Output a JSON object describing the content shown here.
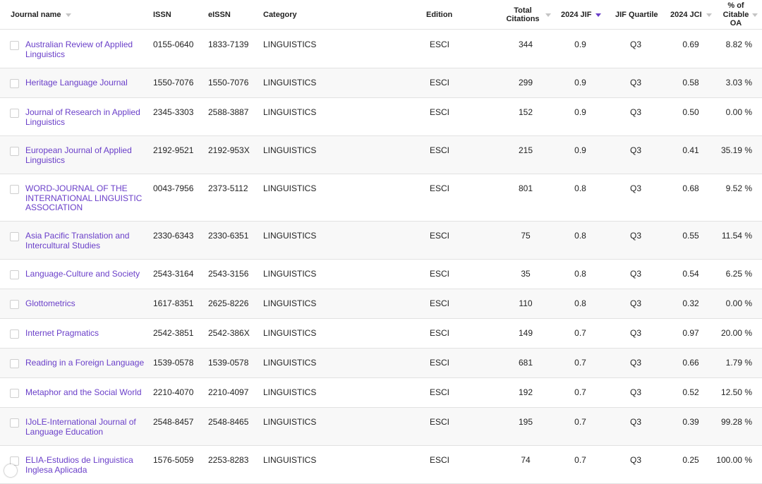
{
  "columns": {
    "journal_name": "Journal name",
    "issn": "ISSN",
    "eissn": "eISSN",
    "category": "Category",
    "edition": "Edition",
    "total_citations": "Total Citations",
    "jif": "2024 JIF",
    "jif_quartile": "JIF Quartile",
    "jci": "2024 JCI",
    "citable_oa": "% of Citable OA"
  },
  "accent_color": "#6a3fc9",
  "rows": [
    {
      "name": "Australian Review of Applied Linguistics",
      "issn": "0155-0640",
      "eissn": "1833-7139",
      "category": "LINGUISTICS",
      "edition": "ESCI",
      "citations": "344",
      "jif": "0.9",
      "quartile": "Q3",
      "jci": "0.69",
      "oa": "8.82 %"
    },
    {
      "name": "Heritage Language Journal",
      "issn": "1550-7076",
      "eissn": "1550-7076",
      "category": "LINGUISTICS",
      "edition": "ESCI",
      "citations": "299",
      "jif": "0.9",
      "quartile": "Q3",
      "jci": "0.58",
      "oa": "3.03 %"
    },
    {
      "name": "Journal of Research in Applied Linguistics",
      "issn": "2345-3303",
      "eissn": "2588-3887",
      "category": "LINGUISTICS",
      "edition": "ESCI",
      "citations": "152",
      "jif": "0.9",
      "quartile": "Q3",
      "jci": "0.50",
      "oa": "0.00 %"
    },
    {
      "name": "European Journal of Applied Linguistics",
      "issn": "2192-9521",
      "eissn": "2192-953X",
      "category": "LINGUISTICS",
      "edition": "ESCI",
      "citations": "215",
      "jif": "0.9",
      "quartile": "Q3",
      "jci": "0.41",
      "oa": "35.19 %"
    },
    {
      "name": "WORD-JOURNAL OF THE INTERNATIONAL LINGUISTIC ASSOCIATION",
      "issn": "0043-7956",
      "eissn": "2373-5112",
      "category": "LINGUISTICS",
      "edition": "ESCI",
      "citations": "801",
      "jif": "0.8",
      "quartile": "Q3",
      "jci": "0.68",
      "oa": "9.52 %"
    },
    {
      "name": "Asia Pacific Translation and Intercultural Studies",
      "issn": "2330-6343",
      "eissn": "2330-6351",
      "category": "LINGUISTICS",
      "edition": "ESCI",
      "citations": "75",
      "jif": "0.8",
      "quartile": "Q3",
      "jci": "0.55",
      "oa": "11.54 %"
    },
    {
      "name": "Language-Culture and Society",
      "issn": "2543-3164",
      "eissn": "2543-3156",
      "category": "LINGUISTICS",
      "edition": "ESCI",
      "citations": "35",
      "jif": "0.8",
      "quartile": "Q3",
      "jci": "0.54",
      "oa": "6.25 %"
    },
    {
      "name": "Glottometrics",
      "issn": "1617-8351",
      "eissn": "2625-8226",
      "category": "LINGUISTICS",
      "edition": "ESCI",
      "citations": "110",
      "jif": "0.8",
      "quartile": "Q3",
      "jci": "0.32",
      "oa": "0.00 %"
    },
    {
      "name": "Internet Pragmatics",
      "issn": "2542-3851",
      "eissn": "2542-386X",
      "category": "LINGUISTICS",
      "edition": "ESCI",
      "citations": "149",
      "jif": "0.7",
      "quartile": "Q3",
      "jci": "0.97",
      "oa": "20.00 %"
    },
    {
      "name": "Reading in a Foreign Language",
      "issn": "1539-0578",
      "eissn": "1539-0578",
      "category": "LINGUISTICS",
      "edition": "ESCI",
      "citations": "681",
      "jif": "0.7",
      "quartile": "Q3",
      "jci": "0.66",
      "oa": "1.79 %"
    },
    {
      "name": "Metaphor and the Social World",
      "issn": "2210-4070",
      "eissn": "2210-4097",
      "category": "LINGUISTICS",
      "edition": "ESCI",
      "citations": "192",
      "jif": "0.7",
      "quartile": "Q3",
      "jci": "0.52",
      "oa": "12.50 %"
    },
    {
      "name": "IJoLE-International Journal of Language Education",
      "issn": "2548-8457",
      "eissn": "2548-8465",
      "category": "LINGUISTICS",
      "edition": "ESCI",
      "citations": "195",
      "jif": "0.7",
      "quartile": "Q3",
      "jci": "0.39",
      "oa": "99.28 %"
    },
    {
      "name": "ELIA-Estudios de Linguistica Inglesa Aplicada",
      "issn": "1576-5059",
      "eissn": "2253-8283",
      "category": "LINGUISTICS",
      "edition": "ESCI",
      "citations": "74",
      "jif": "0.7",
      "quartile": "Q3",
      "jci": "0.25",
      "oa": "100.00 %"
    }
  ]
}
